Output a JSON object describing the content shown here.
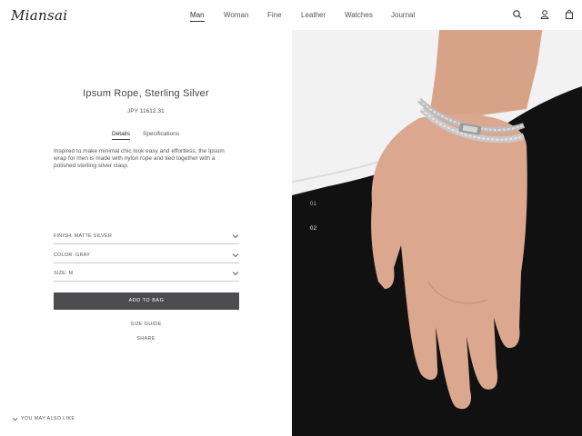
{
  "header": {
    "logo": "Miansai",
    "nav": [
      "Man",
      "Woman",
      "Fine",
      "Leather",
      "Watches",
      "Journal"
    ],
    "active_nav": "Man",
    "icons": [
      "search-icon",
      "user-icon",
      "bag-icon"
    ]
  },
  "product": {
    "title": "Ipsum Rope, Sterling Silver",
    "price": "JPY 11612.31",
    "tabs": [
      "Details",
      "Specifications"
    ],
    "active_tab": "Details",
    "description": "Inspired to make minimal chic look easy and effortless, the Ipsum wrap for men is made with nylon rope and tied together with a polished sterling silver clasp."
  },
  "options": {
    "finish": "FINISH: MATTE SILVER",
    "color": "COLOR: GRAY",
    "size": "SIZE: M"
  },
  "actions": {
    "add_to_bag": "ADD TO BAG",
    "size_guide": "SIZE GUIDE",
    "share": "SHARE",
    "also_like": "YOU MAY ALSO LIKE"
  },
  "gallery": {
    "images": [
      "01",
      "02"
    ]
  },
  "colors": {
    "button": "#4d4d4f",
    "shirt": "#f3f3f3",
    "pants": "#111111",
    "skin": "#d9a78d"
  }
}
